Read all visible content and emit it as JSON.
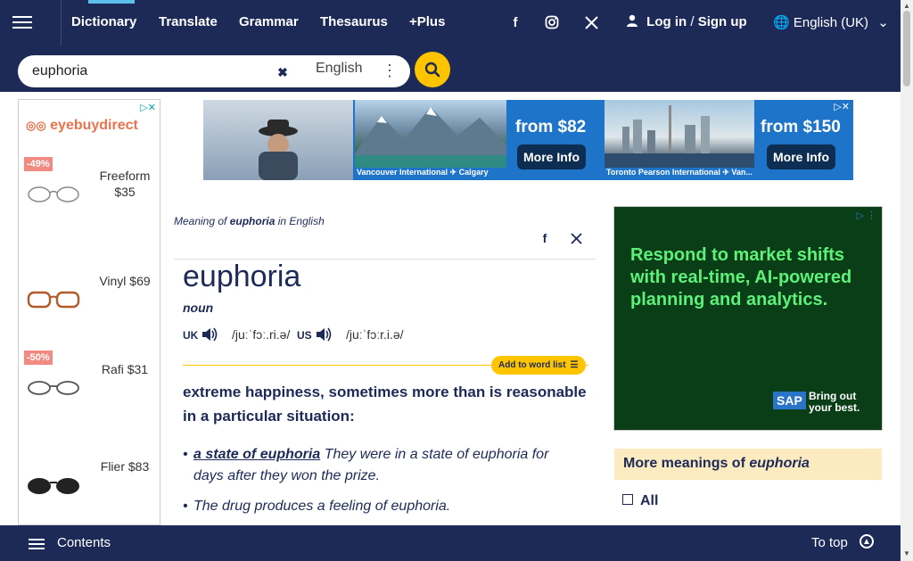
{
  "nav": {
    "items": [
      {
        "label": "Dictionary"
      },
      {
        "label": "Translate"
      },
      {
        "label": "Grammar"
      },
      {
        "label": "Thesaurus"
      },
      {
        "label": "+Plus"
      }
    ],
    "login": "Log in",
    "slash": "/",
    "signup": "Sign up",
    "language": "English (UK)",
    "social": [
      "facebook-icon",
      "instagram-icon",
      "x-icon"
    ]
  },
  "search": {
    "value": "euphoria",
    "placeholder": "Search English",
    "dictionary": "English"
  },
  "left_ad": {
    "brand": "eyebuydirect",
    "products": [
      {
        "badge": "-49%",
        "label": "Freeform $35"
      },
      {
        "badge": "",
        "label": "Vinyl $69"
      },
      {
        "badge": "-50%",
        "label": "Rafi $31"
      },
      {
        "badge": "",
        "label": "Flier $83"
      }
    ]
  },
  "top_ad": {
    "caption1": "Vancouver International ✈ Calgary",
    "price1": "from $82",
    "cta1": "More Info",
    "caption2": "Toronto Pearson International ✈ Van...",
    "price2": "from $150",
    "cta2": "More Info"
  },
  "entry": {
    "meaning_prefix": "Meaning of ",
    "meaning_word": "euphoria",
    "meaning_suffix": " in English",
    "headword": "euphoria",
    "pos": "noun",
    "uk_label": "UK",
    "uk_ipa": "/juːˈfɔː.ri.ə/",
    "us_label": "US",
    "us_ipa": "/juːˈfɔːr.i.ə/",
    "add_to_list": "Add to word list",
    "definition": {
      "w1": "extreme",
      "w2": "happiness",
      "t1": ", sometimes more than is ",
      "w3": "reasonable",
      "t2": " in a ",
      "w4": "particular",
      "t3": " ",
      "w5": "situation",
      "t4": ":"
    },
    "example1": {
      "w1": "a state of euphoria",
      "t1": " They were in a ",
      "w2": "state",
      "t2": " of euphoria for ",
      "w3": "days",
      "t3": " after they ",
      "w4": "won",
      "t4": " the ",
      "w5": "prize",
      "t5": "."
    },
    "example2": {
      "t0": "The ",
      "w1": "drug",
      "t1": " ",
      "w2": "produces",
      "t2": " a ",
      "w3": "feeling",
      "t3": " of euphoria."
    }
  },
  "right_ad": {
    "headline": "Respond to market shifts with real-time, AI-powered planning and analytics.",
    "logo": "SAP",
    "tagline": "Bring out your best."
  },
  "more_meanings": {
    "prefix": "More meanings of ",
    "word": "euphoria",
    "all": "All"
  },
  "bottom": {
    "contents": "Contents",
    "totop": "To top"
  }
}
